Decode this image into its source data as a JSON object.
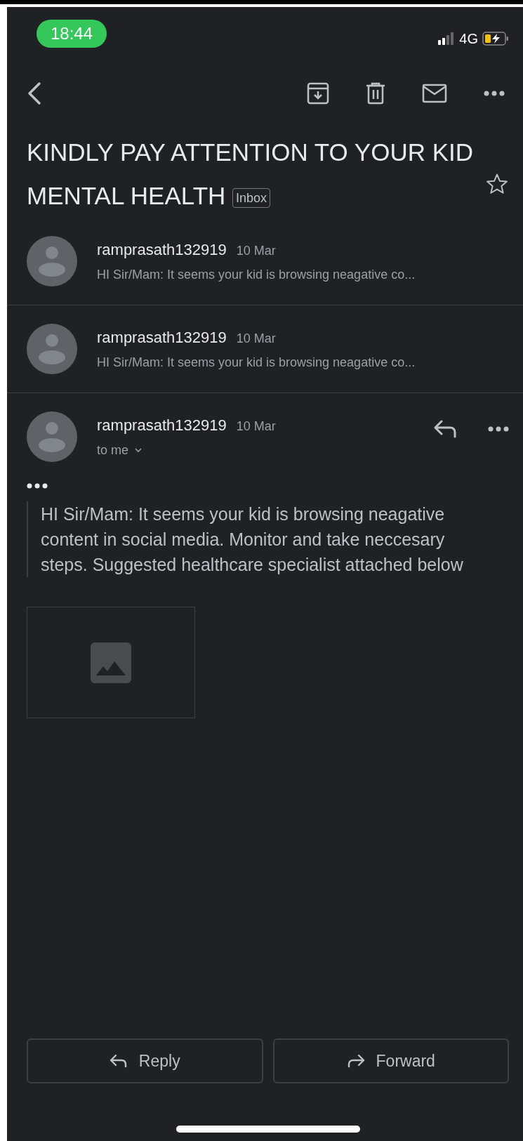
{
  "status_bar": {
    "time": "18:44",
    "network": "4G"
  },
  "subject": {
    "title": "KINDLY PAY ATTENTION TO YOUR KID MENTAL HEALTH",
    "label": "Inbox",
    "starred": false
  },
  "messages": [
    {
      "sender": "ramprasath132919",
      "date": "10 Mar",
      "snippet": "HI Sir/Mam: It seems your kid is browsing neagative co...",
      "expanded": false
    },
    {
      "sender": "ramprasath132919",
      "date": "10 Mar",
      "snippet": "HI Sir/Mam: It seems your kid is browsing neagative co...",
      "expanded": false
    },
    {
      "sender": "ramprasath132919",
      "date": "10 Mar",
      "recipient": "to me",
      "expanded": true
    }
  ],
  "body": "HI Sir/Mam: It seems your kid is browsing neagative content in social media. Monitor and take neccesary steps. Suggested healthcare specialist attached below",
  "attachments": [
    {
      "kind": "image"
    }
  ],
  "buttons": [
    {
      "kind": "reply",
      "label": "Reply"
    },
    {
      "kind": "forward",
      "label": "Forward"
    }
  ]
}
